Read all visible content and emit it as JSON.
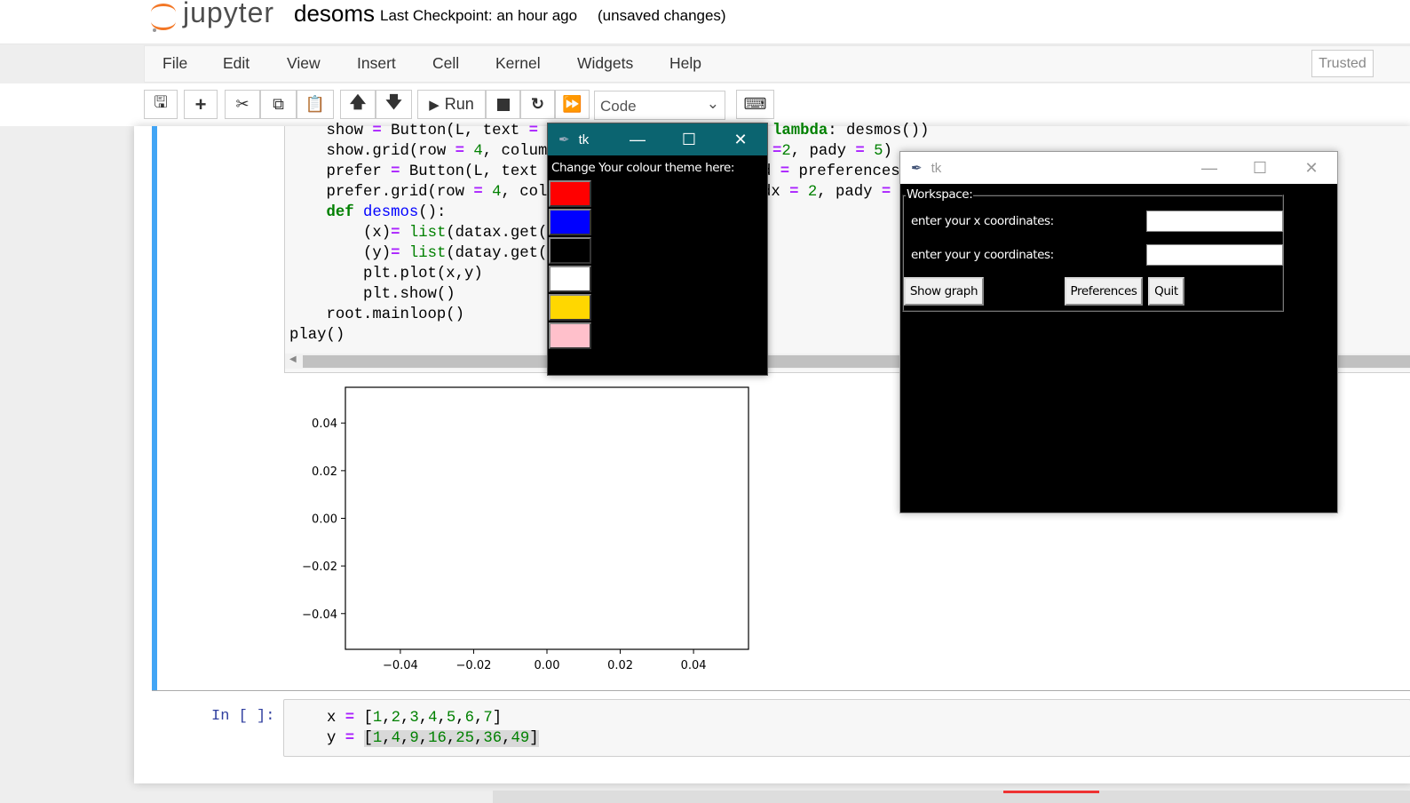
{
  "header": {
    "logo_text": "jupyter",
    "notebook_name": "desoms",
    "checkpoint": "Last Checkpoint: an hour ago",
    "unsaved": "(unsaved changes)",
    "trusted": "Trusted"
  },
  "menu": [
    "File",
    "Edit",
    "View",
    "Insert",
    "Cell",
    "Kernel",
    "Widgets",
    "Help"
  ],
  "toolbar": {
    "run_label": "Run",
    "cell_type": "Code",
    "icons": [
      "save-icon",
      "plus-icon",
      "cut-icon",
      "copy-icon",
      "paste-icon",
      "arrow-up-icon",
      "arrow-down-icon",
      "run-icon",
      "stop-icon",
      "restart-icon",
      "fast-forward-icon",
      "keyboard-icon"
    ]
  },
  "cell1": {
    "lines_left": [
      [
        [
          "    show ",
          ""
        ],
        [
          "=",
          "op"
        ],
        [
          " Button(L, text ",
          ""
        ],
        [
          "=",
          "op"
        ]
      ],
      [
        [
          "    show.grid(row ",
          ""
        ],
        [
          "=",
          "op"
        ],
        [
          " ",
          ""
        ],
        [
          "4",
          "num"
        ],
        [
          ", colum",
          ""
        ]
      ],
      [
        [
          "    prefer ",
          ""
        ],
        [
          "=",
          "op"
        ],
        [
          " Button(L, text",
          ""
        ]
      ],
      [
        [
          "    prefer.grid(row ",
          ""
        ],
        [
          "=",
          "op"
        ],
        [
          " ",
          ""
        ],
        [
          "4",
          "num"
        ],
        [
          ", col",
          ""
        ]
      ],
      [
        [
          "    ",
          ""
        ],
        [
          "def",
          "kw"
        ],
        [
          " ",
          ""
        ],
        [
          "desmos",
          "fn"
        ],
        [
          "():",
          ""
        ]
      ],
      [
        [
          "        (x)",
          ""
        ],
        [
          "=",
          "op"
        ],
        [
          " ",
          ""
        ],
        [
          "list",
          "bi"
        ],
        [
          "(datax.get(",
          ""
        ]
      ],
      [
        [
          "        (y)",
          ""
        ],
        [
          "=",
          "op"
        ],
        [
          " ",
          ""
        ],
        [
          "list",
          "bi"
        ],
        [
          "(datay.get(",
          ""
        ]
      ],
      [
        [
          "        plt.plot(x,y)",
          ""
        ]
      ],
      [
        [
          "        plt.show()",
          ""
        ]
      ],
      [
        [
          "    root.mainloop()",
          ""
        ]
      ],
      [
        [
          "play()",
          ""
        ]
      ]
    ],
    "lines_right": [
      [
        [
          "lambda",
          "kw"
        ],
        [
          ": desmos())",
          ""
        ]
      ],
      [
        [
          "=",
          "op"
        ],
        [
          "2",
          "num"
        ],
        [
          ", pady ",
          ""
        ],
        [
          "=",
          "op"
        ],
        [
          " ",
          ""
        ],
        [
          "5",
          "num"
        ],
        [
          ")",
          ""
        ]
      ],
      [
        [
          "d ",
          ""
        ],
        [
          "=",
          "op"
        ],
        [
          " preferences",
          ""
        ]
      ],
      [
        [
          "dx ",
          ""
        ],
        [
          "=",
          "op"
        ],
        [
          " ",
          ""
        ],
        [
          "2",
          "num"
        ],
        [
          ", pady ",
          ""
        ],
        [
          "=",
          "op"
        ]
      ]
    ]
  },
  "chart_data": {
    "type": "line",
    "series": [
      {
        "x": [],
        "y": []
      }
    ],
    "xlim": [
      -0.055,
      0.055
    ],
    "ylim": [
      -0.055,
      0.055
    ],
    "xticks": [
      -0.04,
      -0.02,
      0.0,
      0.02,
      0.04
    ],
    "yticks": [
      -0.04,
      -0.02,
      0.0,
      0.02,
      0.04
    ],
    "xtick_labels": [
      "−0.04",
      "−0.02",
      "0.00",
      "0.02",
      "0.04"
    ],
    "ytick_labels": [
      "−0.04",
      "−0.02",
      "0.00",
      "0.02",
      "0.04"
    ],
    "grid": false
  },
  "cell2": {
    "prompt": "In [ ]:",
    "lines": [
      [
        [
          "x ",
          ""
        ],
        [
          "=",
          "op"
        ],
        [
          " [",
          ""
        ],
        [
          "1",
          "num"
        ],
        [
          ",",
          ""
        ],
        [
          "2",
          "num"
        ],
        [
          ",",
          ""
        ],
        [
          "3",
          "num"
        ],
        [
          ",",
          ""
        ],
        [
          "4",
          "num"
        ],
        [
          ",",
          ""
        ],
        [
          "5",
          "num"
        ],
        [
          ",",
          ""
        ],
        [
          "6",
          "num"
        ],
        [
          ",",
          ""
        ],
        [
          "7",
          "num"
        ],
        [
          "]",
          ""
        ]
      ],
      [
        [
          "y ",
          ""
        ],
        [
          "=",
          "op"
        ],
        [
          " ",
          ""
        ],
        [
          "[",
          "hl"
        ],
        [
          "1",
          "num hl"
        ],
        [
          ",",
          "hl"
        ],
        [
          "4",
          "num hl"
        ],
        [
          ",",
          "hl"
        ],
        [
          "9",
          "num hl"
        ],
        [
          ",",
          "hl"
        ],
        [
          "16",
          "num hl"
        ],
        [
          ",",
          "hl"
        ],
        [
          "25",
          "num hl"
        ],
        [
          ",",
          "hl"
        ],
        [
          "36",
          "num hl"
        ],
        [
          ",",
          "hl"
        ],
        [
          "49",
          "num hl"
        ],
        [
          "]",
          "hl"
        ]
      ]
    ]
  },
  "tk_theme": {
    "title": "tk",
    "label": "Change Your colour theme here:",
    "swatches": [
      {
        "name": "red",
        "color": "#ff0000"
      },
      {
        "name": "blue",
        "color": "#0000ff"
      },
      {
        "name": "black",
        "color": "#000000"
      },
      {
        "name": "white",
        "color": "#ffffff"
      },
      {
        "name": "gold",
        "color": "#ffd700"
      },
      {
        "name": "pink",
        "color": "#ffc0cb"
      }
    ],
    "titlebar_color": "#0b6470"
  },
  "tk_main": {
    "title": "tk",
    "frame_label": "Workspace:",
    "x_label": "enter your x  coordinates:",
    "y_label": "enter your y coordinates:",
    "x_value": "",
    "y_value": "",
    "show_graph": "Show graph",
    "preferences": "Preferences",
    "quit": "Quit"
  }
}
